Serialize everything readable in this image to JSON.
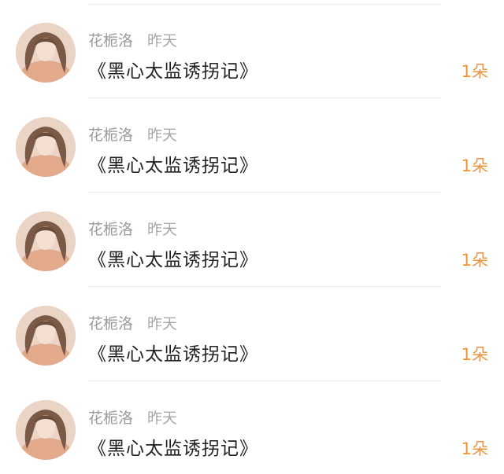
{
  "items": [
    {
      "user": "花栀洛",
      "time": "昨天",
      "title": "《黑心太监诱拐记》",
      "count": "1朵",
      "avatar": "avatar-photo"
    },
    {
      "user": "花栀洛",
      "time": "昨天",
      "title": "《黑心太监诱拐记》",
      "count": "1朵",
      "avatar": "avatar-photo"
    },
    {
      "user": "花栀洛",
      "time": "昨天",
      "title": "《黑心太监诱拐记》",
      "count": "1朵",
      "avatar": "avatar-photo"
    },
    {
      "user": "花栀洛",
      "time": "昨天",
      "title": "《黑心太监诱拐记》",
      "count": "1朵",
      "avatar": "avatar-photo"
    },
    {
      "user": "花栀洛",
      "time": "昨天",
      "title": "《黑心太监诱拐记》",
      "count": "1朵",
      "avatar": "avatar-photo"
    }
  ],
  "colors": {
    "count_accent": "#f0953a",
    "name_gray": "#9a9a9a",
    "title_text": "#222222",
    "divider": "#ececec"
  }
}
